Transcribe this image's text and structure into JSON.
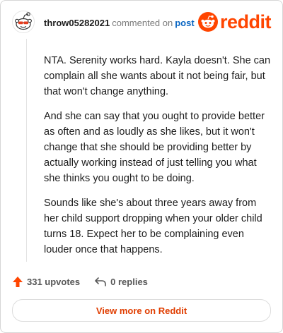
{
  "header": {
    "username": "throw05282021",
    "action_text": "commented on",
    "post_link_label": "post",
    "brand_word": "reddit"
  },
  "comment": {
    "paragraphs": [
      "NTA. Serenity works hard. Kayla doesn't. She can complain all she wants about it not being fair, but that won't change anything.",
      "And she can say that you ought to provide better as often and as loudly as she likes, but it won't change that she should be providing better by actually working instead of just telling you what she thinks you ought to be doing.",
      "Sounds like she's about three years away from her child support dropping when your older child turns 18. Expect her to be complaining even louder once that happens."
    ]
  },
  "footer": {
    "upvotes_label": "331 upvotes",
    "replies_label": "0 replies",
    "view_more_label": "View more on Reddit"
  },
  "icons": {
    "upvote": "upvote-arrow-icon",
    "reply": "reply-arrow-icon",
    "brand": "reddit-snoo-icon",
    "avatar": "snoo-avatar"
  },
  "colors": {
    "brand": "#ff4500",
    "upvote": "#ff4500",
    "link": "#0a66c2",
    "view_more": "#e03d00"
  }
}
